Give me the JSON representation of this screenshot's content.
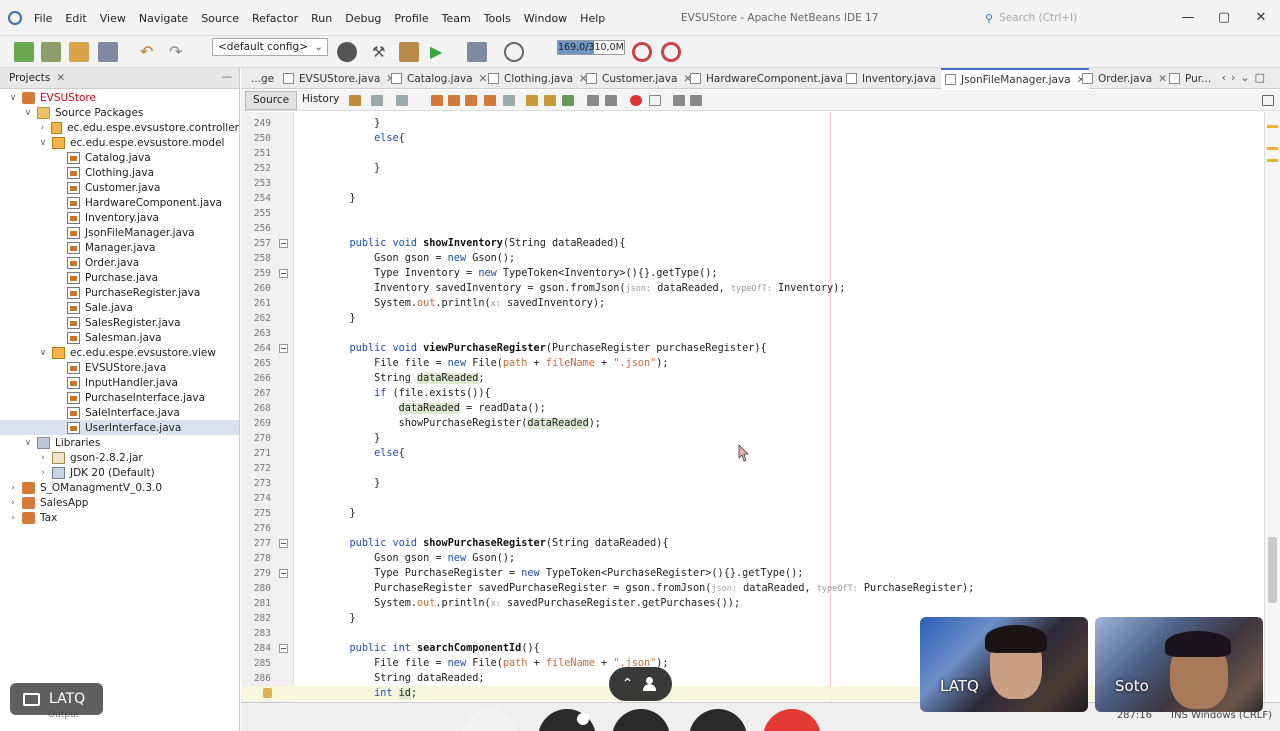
{
  "window": {
    "title": "EVSUStore - Apache NetBeans IDE 17",
    "search_placeholder": "Search (Ctrl+I)"
  },
  "menu": [
    "File",
    "Edit",
    "View",
    "Navigate",
    "Source",
    "Refactor",
    "Run",
    "Debug",
    "Profile",
    "Team",
    "Tools",
    "Window",
    "Help"
  ],
  "toolbar": {
    "config": "<default config>",
    "memory": "169,0/310,0MB",
    "memory_used_fraction": 0.545
  },
  "projects": {
    "tab_label": "Projects",
    "tree": [
      {
        "label": "EVSUStore",
        "depth": 0,
        "icon": "project-icon",
        "expanded": true,
        "color": "#d0021b"
      },
      {
        "label": "Source Packages",
        "depth": 1,
        "icon": "package-folder-icon",
        "expanded": true
      },
      {
        "label": "ec.edu.espe.evsustore.controller",
        "depth": 2,
        "icon": "package-icon",
        "expanded": false
      },
      {
        "label": "ec.edu.espe.evsustore.model",
        "depth": 2,
        "icon": "package-icon",
        "expanded": true
      },
      {
        "label": "Catalog.java",
        "depth": 3,
        "icon": "java-file-icon"
      },
      {
        "label": "Clothing.java",
        "depth": 3,
        "icon": "java-file-icon"
      },
      {
        "label": "Customer.java",
        "depth": 3,
        "icon": "java-file-icon"
      },
      {
        "label": "HardwareComponent.java",
        "depth": 3,
        "icon": "java-file-icon"
      },
      {
        "label": "Inventory.java",
        "depth": 3,
        "icon": "java-file-icon"
      },
      {
        "label": "JsonFileManager.java",
        "depth": 3,
        "icon": "java-file-icon"
      },
      {
        "label": "Manager.java",
        "depth": 3,
        "icon": "java-file-icon"
      },
      {
        "label": "Order.java",
        "depth": 3,
        "icon": "java-file-icon"
      },
      {
        "label": "Purchase.java",
        "depth": 3,
        "icon": "java-file-icon"
      },
      {
        "label": "PurchaseRegister.java",
        "depth": 3,
        "icon": "java-file-icon"
      },
      {
        "label": "Sale.java",
        "depth": 3,
        "icon": "java-file-icon"
      },
      {
        "label": "SalesRegister.java",
        "depth": 3,
        "icon": "java-file-icon"
      },
      {
        "label": "Salesman.java",
        "depth": 3,
        "icon": "java-file-icon"
      },
      {
        "label": "ec.edu.espe.evsustore.view",
        "depth": 2,
        "icon": "package-icon",
        "expanded": true
      },
      {
        "label": "EVSUStore.java",
        "depth": 3,
        "icon": "java-file-icon"
      },
      {
        "label": "InputHandler.java",
        "depth": 3,
        "icon": "java-file-icon"
      },
      {
        "label": "PurchaseInterface.java",
        "depth": 3,
        "icon": "java-file-icon"
      },
      {
        "label": "SaleInterface.java",
        "depth": 3,
        "icon": "java-file-icon"
      },
      {
        "label": "UserInterface.java",
        "depth": 3,
        "icon": "java-file-icon",
        "selected": true
      },
      {
        "label": "Libraries",
        "depth": 1,
        "icon": "libraries-icon",
        "expanded": true
      },
      {
        "label": "gson-2.8.2.jar",
        "depth": 2,
        "icon": "jar-icon",
        "expanded": false
      },
      {
        "label": "JDK 20 (Default)",
        "depth": 2,
        "icon": "jdk-icon",
        "expanded": false
      },
      {
        "label": "S_OManagmentV_0.3.0",
        "depth": 0,
        "icon": "project-icon",
        "expanded": false
      },
      {
        "label": "SalesApp",
        "depth": 0,
        "icon": "project-icon",
        "expanded": false
      },
      {
        "label": "Tax",
        "depth": 0,
        "icon": "project-icon",
        "expanded": false
      }
    ]
  },
  "editor": {
    "tabs": [
      {
        "label": "...ge",
        "close": false
      },
      {
        "label": "EVSUStore.java",
        "close": true
      },
      {
        "label": "Catalog.java",
        "close": true
      },
      {
        "label": "Clothing.java",
        "close": true
      },
      {
        "label": "Customer.java",
        "close": true
      },
      {
        "label": "HardwareComponent.java",
        "close": true
      },
      {
        "label": "Inventory.java",
        "close": true
      },
      {
        "label": "JsonFileManager.java",
        "close": true,
        "active": true
      },
      {
        "label": "Order.java",
        "close": true
      },
      {
        "label": "Pur...",
        "close": false
      }
    ],
    "source_label": "Source",
    "history_label": "History",
    "lines": [
      {
        "n": "249",
        "html": "        }"
      },
      {
        "n": "250",
        "html": "        <span class=\"kw\">else</span>{"
      },
      {
        "n": "251",
        "html": ""
      },
      {
        "n": "252",
        "html": "        }"
      },
      {
        "n": "253",
        "html": ""
      },
      {
        "n": "254",
        "html": "    }"
      },
      {
        "n": "255",
        "html": ""
      },
      {
        "n": "256",
        "html": ""
      },
      {
        "n": "257",
        "html": "    <span class=\"kw\">public void</span> <span class=\"fn\">showInventory</span>(String dataReaded){",
        "fold": true
      },
      {
        "n": "258",
        "html": "        Gson gson = <span class=\"kw\">new</span> Gson();"
      },
      {
        "n": "259",
        "html": "        Type Inventory = <span class=\"kw\">new</span> TypeToken&lt;Inventory&gt;(){}.getType();",
        "fold": true
      },
      {
        "n": "260",
        "html": "        Inventory savedInventory = gson.fromJson(<span class=\"hint\">json:</span> dataReaded, <span class=\"hint\">typeOfT:</span> Inventory);"
      },
      {
        "n": "261",
        "html": "        System.<span class=\"fld\">out</span>.println(<span class=\"hint\">x:</span> savedInventory);"
      },
      {
        "n": "262",
        "html": "    }"
      },
      {
        "n": "263",
        "html": ""
      },
      {
        "n": "264",
        "html": "    <span class=\"kw\">public void</span> <span class=\"fn\">viewPurchaseRegister</span>(PurchaseRegister purchaseRegister){",
        "fold": true
      },
      {
        "n": "265",
        "html": "        File file = <span class=\"kw\">new</span> File(<span class=\"fld\">path</span> + <span class=\"fld\">fileName</span> + <span class=\"str\">\".json\"</span>);"
      },
      {
        "n": "266",
        "html": "        String <span class=\"hl\">dataReaded</span>;"
      },
      {
        "n": "267",
        "html": "        <span class=\"kw\">if</span> (file.exists()){"
      },
      {
        "n": "268",
        "html": "            <span class=\"hl\">dataReaded</span> = readData();"
      },
      {
        "n": "269",
        "html": "            showPurchaseRegister(<span class=\"hl\">dataReaded</span>);"
      },
      {
        "n": "270",
        "html": "        }"
      },
      {
        "n": "271",
        "html": "        <span class=\"kw\">else</span>{"
      },
      {
        "n": "272",
        "html": ""
      },
      {
        "n": "273",
        "html": "        }"
      },
      {
        "n": "274",
        "html": ""
      },
      {
        "n": "275",
        "html": "    }"
      },
      {
        "n": "276",
        "html": ""
      },
      {
        "n": "277",
        "html": "    <span class=\"kw\">public void</span> <span class=\"fn\">showPurchaseRegister</span>(String dataReaded){",
        "fold": true
      },
      {
        "n": "278",
        "html": "        Gson gson = <span class=\"kw\">new</span> Gson();"
      },
      {
        "n": "279",
        "html": "        Type PurchaseRegister = <span class=\"kw\">new</span> TypeToken&lt;PurchaseRegister&gt;(){}.getType();",
        "fold": true
      },
      {
        "n": "280",
        "html": "        PurchaseRegister savedPurchaseRegister = gson.fromJson(<span class=\"hint\">json:</span> dataReaded, <span class=\"hint\">typeOfT:</span> PurchaseRegister);"
      },
      {
        "n": "281",
        "html": "        System.<span class=\"fld\">out</span>.println(<span class=\"hint\">x:</span> savedPurchaseRegister.getPurchases());"
      },
      {
        "n": "282",
        "html": "    }"
      },
      {
        "n": "283",
        "html": ""
      },
      {
        "n": "284",
        "html": "    <span class=\"kw\">public int</span> <span class=\"fn\">searchComponentId</span>(){",
        "fold": true
      },
      {
        "n": "285",
        "html": "        File file = <span class=\"kw\">new</span> File(<span class=\"fld\">path</span> + <span class=\"fld\">fileName</span> + <span class=\"str\">\".json\"</span>);"
      },
      {
        "n": "286",
        "html": "        String dataReaded;"
      },
      {
        "n": "",
        "html": "        <span class=\"kw\">int</span> <span class=\"hl\">id</span>;",
        "current": true
      }
    ]
  },
  "status": {
    "position": "287:16",
    "mode": "INS Windows (CRLF)",
    "output_label": "Output"
  },
  "meeting": {
    "presenter": "LATQ",
    "participants": [
      {
        "name": "LATQ"
      },
      {
        "name": "Soto"
      }
    ]
  },
  "colors": {
    "accent": "#3b72c4",
    "keyword": "#1f4fa8",
    "field": "#c46b3a",
    "selected_row": "#d9e2ef"
  }
}
